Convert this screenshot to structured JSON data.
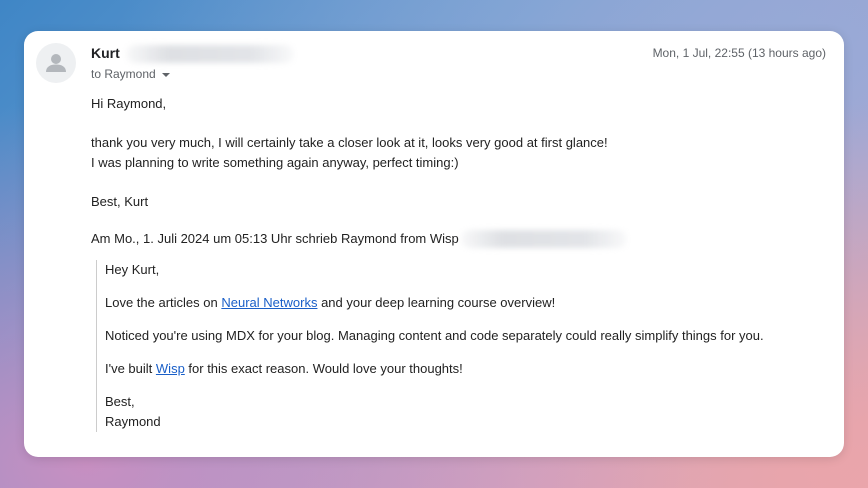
{
  "email": {
    "sender": {
      "name": "Kurt",
      "to": "to Raymond"
    },
    "timestamp": "Mon, 1 Jul, 22:55 (13 hours ago)",
    "body": {
      "greeting": "Hi Raymond,",
      "line1": "thank you very much, I will certainly take a closer look at it, looks very good at first glance!",
      "line2": "I was planning to write something again anyway, perfect timing:)",
      "signoff": "Best, Kurt"
    },
    "attribution": "Am Mo., 1. Juli 2024 um 05:13 Uhr schrieb Raymond from Wisp",
    "quoted": {
      "greeting": "Hey Kurt,",
      "p1_before": "Love the articles on ",
      "p1_link": "Neural Networks",
      "p1_after": " and your deep learning course overview!",
      "p2": "Noticed you're using MDX for your blog. Managing content and code separately could really simplify things for you.",
      "p3_before": "I've built ",
      "p3_link": "Wisp",
      "p3_after": " for this exact reason. Would love your thoughts!",
      "closing": "Best,",
      "name": "Raymond"
    }
  },
  "icons": {
    "avatar": "person-icon",
    "recipient_dropdown": "caret-down-icon"
  },
  "colors": {
    "link": "#1a5fc8",
    "text": "#222222",
    "muted": "#5f6368"
  }
}
